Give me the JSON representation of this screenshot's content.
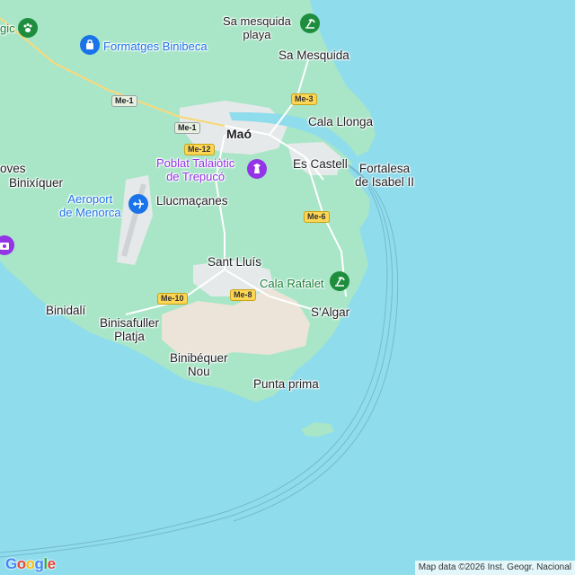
{
  "map": {
    "colors": {
      "sea": "#8fdcec",
      "land": "#a8e6c7",
      "urban": "#e8eaed",
      "sand": "#ede6dc"
    },
    "labels": {
      "sa_mesquida_playa": "Sa mesquida\nplaya",
      "sa_mesquida": "Sa Mesquida",
      "formatges": "Formatges Binibeca",
      "gic": "gic",
      "cala_llonga": "Cala Llonga",
      "mao": "Maó",
      "poblat": "Poblat Talaiòtic\nde Trepucó",
      "es_castell": "Es Castell",
      "fortalesa": "Fortalesa\nde Isabel II",
      "oves": "oves",
      "binixiquer": "Binixíquer",
      "aeroport": "Aeroport\nde Menorca",
      "llucmacanes": "Llucmaçanes",
      "sant_lluis": "Sant Lluís",
      "cala_rafalet": "Cala Rafalet",
      "binidali": "Binidalí",
      "s_algar": "S'Algar",
      "binisafuller": "Binisafuller\nPlatja",
      "binibequer": "Binibéquer\nNou",
      "punta_prima": "Punta prima"
    },
    "roads": {
      "me1a": "Me-1",
      "me1b": "Me-1",
      "me3": "Me-3",
      "me12": "Me-12",
      "me6": "Me-6",
      "me10": "Me-10",
      "me8": "Me-8"
    },
    "icons": {
      "beach1": "beach-icon",
      "shop": "shopping-bag-icon",
      "museum": "monument-icon",
      "airport": "airplane-icon",
      "camera": "camera-icon",
      "beach2": "beach-icon",
      "park": "paw-icon"
    }
  },
  "footer": {
    "google": "Google",
    "attribution": "Map data ©2026 Inst. Geogr. Nacional"
  }
}
